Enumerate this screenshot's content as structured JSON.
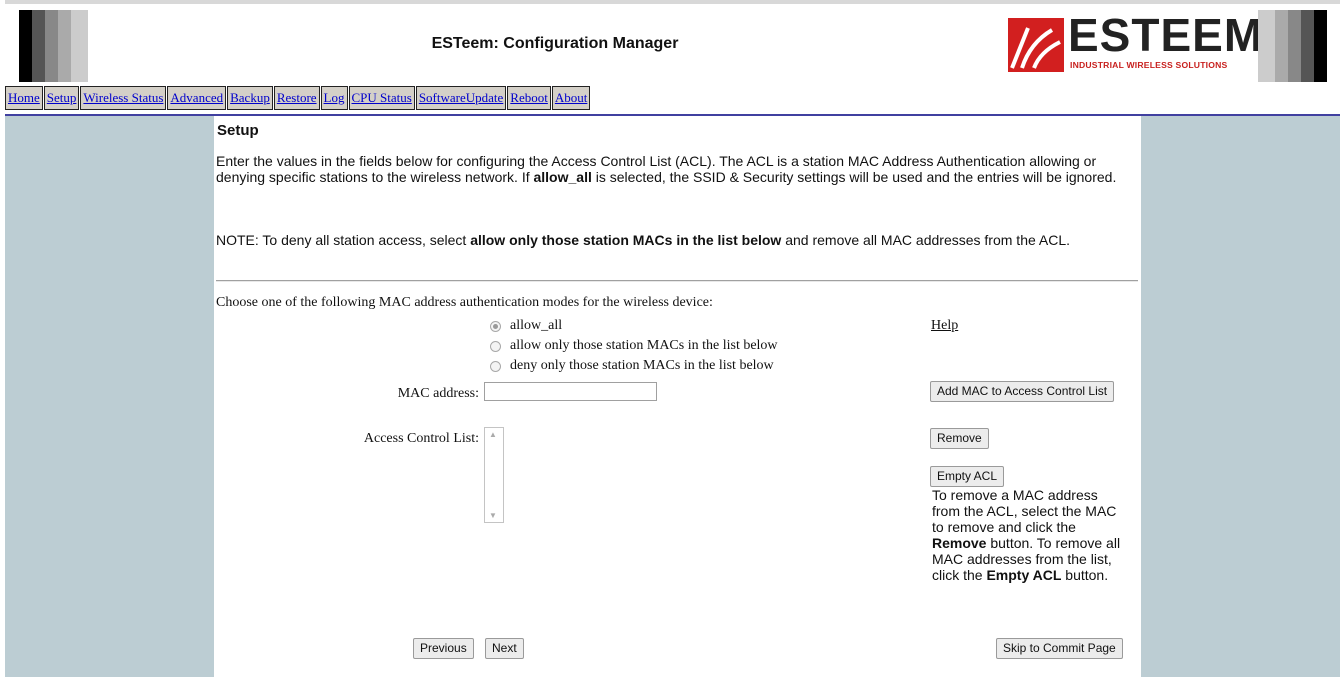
{
  "app_title": "ESTeem: Configuration Manager",
  "logo": {
    "word": "ESTEEM",
    "tagline": "INDUSTRIAL WIRELESS SOLUTIONS",
    "icon": "esteem-logo-mark-icon"
  },
  "nav": {
    "items": [
      "Home",
      "Setup",
      "Wireless Status",
      "Advanced",
      "Backup",
      "Restore",
      "Log",
      "CPU Status",
      "SoftwareUpdate",
      "Reboot",
      "About"
    ]
  },
  "page": {
    "heading": "Setup",
    "intro": {
      "part1": "Enter the values in the fields below for configuring the Access Control List (ACL). The ACL is a station MAC Address Authentication allowing or denying specific stations to the wireless network. If ",
      "bold": "allow_all",
      "part2": " is selected, the SSID & Security settings will be used and the entries will be ignored."
    },
    "note": {
      "part1": "NOTE: To deny all station access, select ",
      "bold": "allow only those station MACs in the list below",
      "part2": " and remove all MAC addresses from the ACL."
    }
  },
  "form": {
    "choose_text": "Choose one of the following MAC address authentication modes for the wireless device:",
    "modes": [
      {
        "label": "allow_all",
        "checked": true
      },
      {
        "label": "allow only those station MACs in the list below",
        "checked": false
      },
      {
        "label": "deny only those station MACs in the list below",
        "checked": false
      }
    ],
    "help_link": "Help",
    "mac_label": "MAC address:",
    "mac_value": "",
    "add_button": "Add MAC to Access Control List",
    "acl_label": "Access Control List:",
    "acl_entries": [],
    "remove_button": "Remove",
    "empty_button": "Empty ACL",
    "acl_help": {
      "t1": "To remove a MAC address from the ACL, select the MAC to remove and click the ",
      "b1": "Remove",
      "t2": " button. To remove all MAC addresses from the list, click the ",
      "b2": "Empty ACL",
      "t3": " button."
    }
  },
  "footer": {
    "previous": "Previous",
    "next": "Next",
    "skip": "Skip to Commit Page"
  },
  "colors": {
    "side_panel": "#bccdd3",
    "nav_bg": "#d4d0c8",
    "logo_red": "#d21f1f",
    "rule": "#4040a0"
  }
}
